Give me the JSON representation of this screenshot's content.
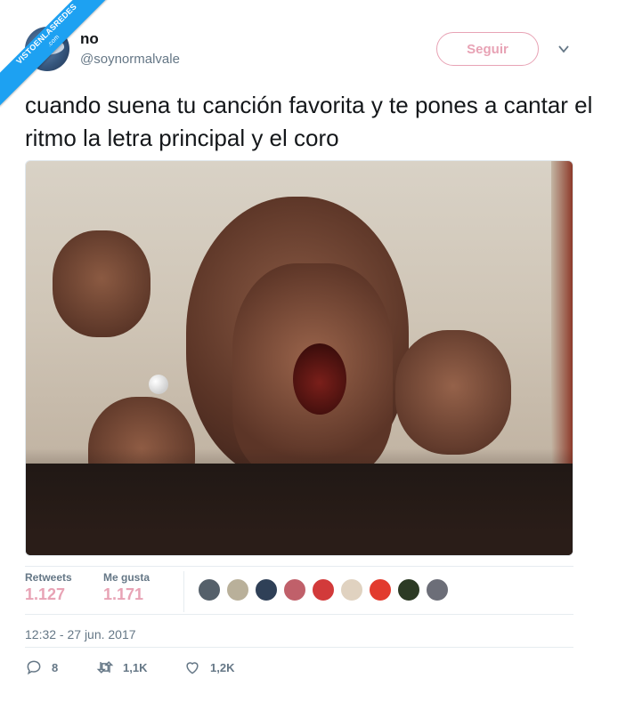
{
  "watermark": {
    "line1": "VISTOENLASREDES",
    "line2": ".com"
  },
  "user": {
    "name": "no",
    "handle": "@soynormalvale"
  },
  "follow_label": "Seguir",
  "tweet_text": "cuando suena tu canción favorita y te pones a cantar el ritmo la letra principal y el coro",
  "stats": {
    "retweets_label": "Retweets",
    "retweets_value": "1.127",
    "likes_label": "Me gusta",
    "likes_value": "1.171"
  },
  "likers": [
    "#55606a",
    "#b9b09a",
    "#2f4057",
    "#c0606a",
    "#d23a3a",
    "#e0d2c0",
    "#e23b2e",
    "#2c3a24",
    "#6c6e78"
  ],
  "timestamp": "12:32 - 27 jun. 2017",
  "actions": {
    "replies": "8",
    "retweets": "1,1K",
    "likes": "1,2K"
  },
  "colors": {
    "accent_pink": "#e8a3b5",
    "muted": "#657786",
    "watermark_blue": "#1da1f2"
  }
}
